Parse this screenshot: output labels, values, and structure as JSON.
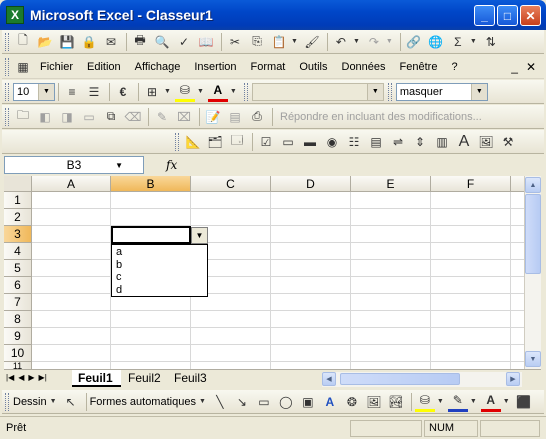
{
  "window": {
    "title": "Microsoft Excel - Classeur1",
    "app_icon": "X"
  },
  "window_buttons": {
    "minimize": "_",
    "maximize": "□",
    "close": "✕"
  },
  "menubar": {
    "items": [
      "Fichier",
      "Edition",
      "Affichage",
      "Insertion",
      "Format",
      "Outils",
      "Données",
      "Fenêtre",
      "?"
    ],
    "right": [
      "_",
      "✕"
    ]
  },
  "format_toolbar": {
    "font_size": "10",
    "style_value": "",
    "style_combo_value": "masquer"
  },
  "review_toolbar": {
    "reply_label": "Répondre en incluant des modifications..."
  },
  "formula_bar": {
    "name_box": "B3",
    "fx": "fx",
    "content": ""
  },
  "grid": {
    "columns": [
      "A",
      "B",
      "C",
      "D",
      "E",
      "F"
    ],
    "active_column": "B",
    "rows": [
      "1",
      "2",
      "3",
      "4",
      "5",
      "6",
      "7",
      "8",
      "9",
      "10",
      "11"
    ],
    "active_row": "3",
    "dropdown_options": [
      "a",
      "b",
      "c",
      "d"
    ]
  },
  "sheets": {
    "tabs": [
      "Feuil1",
      "Feuil2",
      "Feuil3"
    ],
    "active": "Feuil1"
  },
  "drawing_toolbar": {
    "draw_label": "Dessin",
    "autoshapes_label": "Formes automatiques"
  },
  "status": {
    "text": "Prêt",
    "num": "NUM"
  }
}
